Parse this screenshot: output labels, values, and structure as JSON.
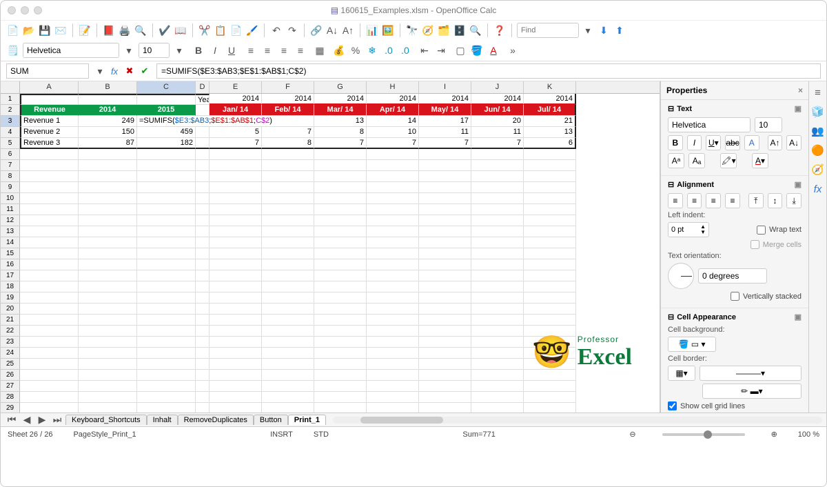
{
  "window": {
    "title": "160615_Examples.xlsm - OpenOffice Calc"
  },
  "find": {
    "placeholder": "Find"
  },
  "font": {
    "name": "Helvetica",
    "size": "10"
  },
  "active_cell": "SUM",
  "formula": "=SUMIFS($E3:$AB3;$E$1:$AB$1;C$2)",
  "formula_parts": {
    "prefix": "=SUMIFS(",
    "p1": "$E3:$AB3",
    "sep1": ";",
    "p2": "$E$1:$AB$1",
    "sep2": ";",
    "p3": "C$2",
    "suffix": ")"
  },
  "cols": [
    "A",
    "B",
    "C",
    "D",
    "E",
    "F",
    "G",
    "H",
    "I",
    "J",
    "K"
  ],
  "row1": {
    "label_D": "Year:",
    "years": [
      "2014",
      "2014",
      "2014",
      "2014",
      "2014",
      "2014",
      "2014"
    ]
  },
  "row2": {
    "A": "Revenue",
    "B": "2014",
    "C": "2015",
    "months": [
      "Jan/ 14",
      "Feb/ 14",
      "Mar/ 14",
      "Apr/ 14",
      "May/ 14",
      "Jun/ 14",
      "Jul/ 14"
    ]
  },
  "data_rows": [
    {
      "A": "Revenue 1",
      "B": "249",
      "C_formula": true,
      "vals": [
        "",
        "",
        "13",
        "14",
        "17",
        "20",
        "21"
      ]
    },
    {
      "A": "Revenue 2",
      "B": "150",
      "C": "459",
      "vals": [
        "5",
        "7",
        "8",
        "10",
        "11",
        "11",
        "13"
      ]
    },
    {
      "A": "Revenue 3",
      "B": "87",
      "C": "182",
      "vals": [
        "7",
        "8",
        "7",
        "7",
        "7",
        "7",
        "6"
      ]
    }
  ],
  "tabs": [
    "Keyboard_Shortcuts",
    "Inhalt",
    "RemoveDuplicates",
    "Button",
    "Print_1"
  ],
  "active_tab": "Print_1",
  "status": {
    "sheet": "Sheet 26 / 26",
    "pagestyle": "PageStyle_Print_1",
    "insrt": "INSRT",
    "std": "STD",
    "sum": "Sum=771",
    "zoom": "100 %"
  },
  "side": {
    "title": "Properties",
    "text_label": "Text",
    "align_label": "Alignment",
    "indent_label": "Left indent:",
    "indent_value": "0 pt",
    "wrap": "Wrap text",
    "merge": "Merge cells",
    "orient_label": "Text orientation:",
    "orient_value": "0 degrees",
    "vstack": "Vertically stacked",
    "cellapp": "Cell Appearance",
    "bg": "Cell background:",
    "border": "Cell border:",
    "grid": "Show cell grid lines"
  },
  "logo": {
    "top": "Professor",
    "main": "Excel"
  }
}
